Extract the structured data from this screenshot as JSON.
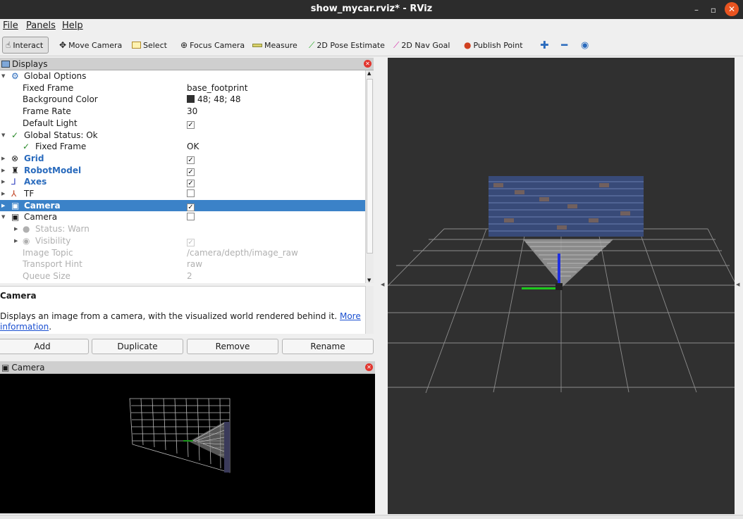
{
  "window": {
    "title": "show_mycar.rviz* - RViz",
    "minimize": "–",
    "maximize": "▫",
    "close": "✕"
  },
  "menu": [
    "File",
    "Panels",
    "Help"
  ],
  "toolbar": {
    "interact": "Interact",
    "move_camera": "Move Camera",
    "select": "Select",
    "focus_camera": "Focus Camera",
    "measure": "Measure",
    "pose_estimate": "2D Pose Estimate",
    "nav_goal": "2D Nav Goal",
    "publish_point": "Publish Point"
  },
  "displays_panel": {
    "title": "Displays",
    "rows": {
      "global_options": "Global Options",
      "fixed_frame_label": "Fixed Frame",
      "fixed_frame_value": "base_footprint",
      "bg_color_label": "Background Color",
      "bg_color_value": "48; 48; 48",
      "frame_rate_label": "Frame Rate",
      "frame_rate_value": "30",
      "default_light_label": "Default Light",
      "global_status": "Global Status: Ok",
      "status_fixed_frame": "Fixed Frame",
      "status_fixed_frame_value": "OK",
      "grid": "Grid",
      "robot_model": "RobotModel",
      "axes": "Axes",
      "tf": "TF",
      "camera_selected": "Camera",
      "camera2": "Camera",
      "status_warn": "Status: Warn",
      "visibility": "Visibility",
      "image_topic_label": "Image Topic",
      "image_topic_value": "/camera/depth/image_raw",
      "transport_hint_label": "Transport Hint",
      "transport_hint_value": "raw",
      "queue_size_label": "Queue Size",
      "queue_size_value": "2"
    },
    "checks": {
      "default_light": true,
      "grid": true,
      "robot_model": true,
      "axes": true,
      "tf": false,
      "camera_selected": true,
      "camera2": false,
      "visibility": true
    },
    "bg_color_hex": "#303030"
  },
  "description": {
    "title": "Camera",
    "text": "Displays an image from a camera, with the visualized world rendered behind it.",
    "link1": "More",
    "link2": "information",
    "tail": "."
  },
  "buttons": {
    "add": "Add",
    "duplicate": "Duplicate",
    "remove": "Remove",
    "rename": "Rename"
  },
  "camera_panel": {
    "title": "Camera"
  },
  "colors": {
    "accent_selected": "#3b82c8",
    "view_bg": "#303030",
    "grid_line": "#8c8c8c"
  }
}
